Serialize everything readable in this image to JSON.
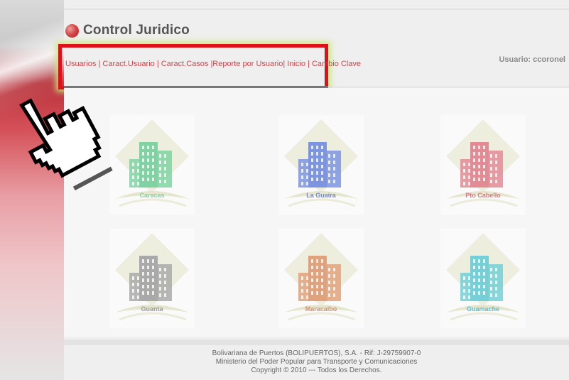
{
  "app": {
    "title": "Control Juridico",
    "user_label": "Usuario: ccoronel"
  },
  "nav": {
    "items": [
      {
        "label": "Usuarios"
      },
      {
        "label": "Caract.Usuario"
      },
      {
        "label": "Caract.Casos"
      },
      {
        "label": "Reporte por Usuario"
      },
      {
        "label": "Inicio"
      },
      {
        "label": "Cambio Clave"
      }
    ]
  },
  "tiles": [
    {
      "label": "Caracas",
      "color": "#7fd3a3",
      "label_color": "#7fd3a3"
    },
    {
      "label": "La Guaira",
      "color": "#7d94e0",
      "label_color": "#6f86d6"
    },
    {
      "label": "Pto Cabello",
      "color": "#e28b95",
      "label_color": "#d67b86"
    },
    {
      "label": "Guanta",
      "color": "#a9a9a9",
      "label_color": "#9a9a9a"
    },
    {
      "label": "Maracaibo",
      "color": "#e0a27c",
      "label_color": "#cf9270"
    },
    {
      "label": "Guamache",
      "color": "#74cfd6",
      "label_color": "#5cbdc6"
    }
  ],
  "footer": {
    "line1": "Bolivariana de Puertos (BOLIPUERTOS), S.A. - Rif: J-29759907-0",
    "line2": "Ministerio del Poder Popular para Transporte y Comunicaciones",
    "line3": "Copyright © 2010 --- Todos los Derechos."
  },
  "icons": {
    "title_bullet": "red-sphere-icon",
    "cursor": "hand-pointer-icon",
    "tile_image": "buildings-icon"
  }
}
